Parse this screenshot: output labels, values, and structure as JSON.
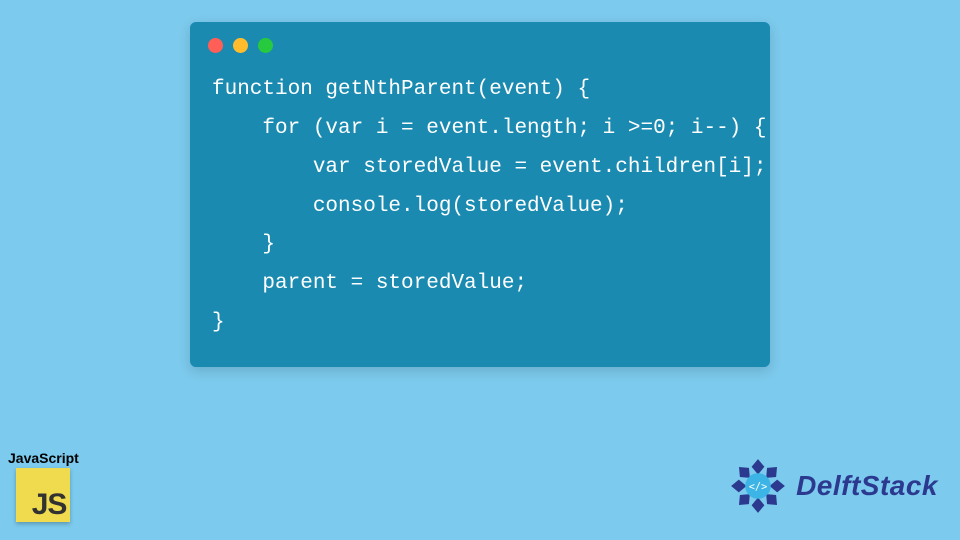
{
  "code": {
    "lines": [
      "function getNthParent(event) {",
      "    for (var i = event.length; i >=0; i--) {",
      "        var storedValue = event.children[i];",
      "        console.log(storedValue);",
      "    }",
      "    parent = storedValue;",
      "}"
    ]
  },
  "badges": {
    "js_label": "JavaScript",
    "js_short": "JS",
    "site_name": "DelftStack"
  },
  "colors": {
    "page_bg": "#7ccaed",
    "card_bg": "#1a8ab0",
    "code_fg": "#ffffff",
    "js_yellow": "#f0db4f",
    "delft_blue": "#2b3a8f"
  }
}
